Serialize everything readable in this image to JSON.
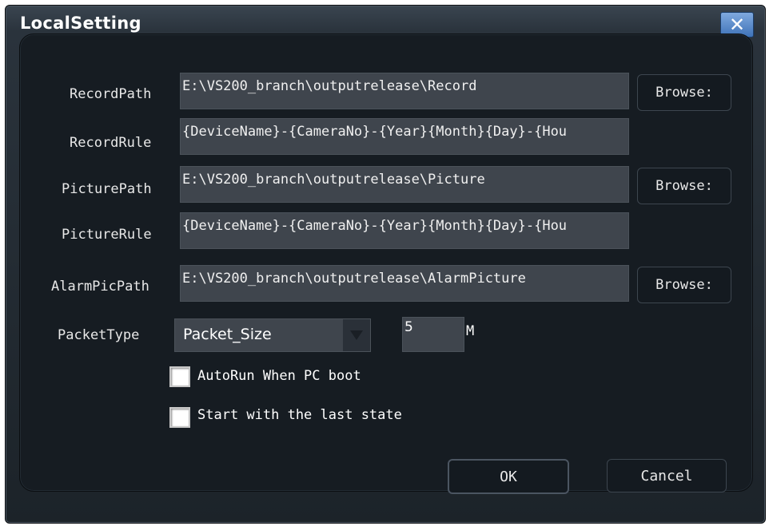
{
  "window": {
    "title": "LocalSetting",
    "close_glyph": "✕"
  },
  "form": {
    "record_path": {
      "label": "RecordPath",
      "value": "E:\\VS200_branch\\outputrelease\\Record",
      "browse_label": "Browse:"
    },
    "record_rule": {
      "label": "RecordRule",
      "value": "{DeviceName}-{CameraNo}-{Year}{Month}{Day}-{Hou"
    },
    "picture_path": {
      "label": "PicturePath",
      "value": "E:\\VS200_branch\\outputrelease\\Picture",
      "browse_label": "Browse:"
    },
    "picture_rule": {
      "label": "PictureRule",
      "value": "{DeviceName}-{CameraNo}-{Year}{Month}{Day}-{Hou"
    },
    "alarm_pic_path": {
      "label": "AlarmPicPath",
      "value": "E:\\VS200_branch\\outputrelease\\AlarmPicture",
      "browse_label": "Browse:"
    },
    "packet_type": {
      "label": "PacketType",
      "selected": "Packet_Size",
      "size_value": "5",
      "unit": "M"
    },
    "autorun": {
      "label": "AutoRun When PC boot",
      "checked": false
    },
    "last_state": {
      "label": "Start with the last state",
      "checked": false
    }
  },
  "buttons": {
    "ok": "OK",
    "cancel": "Cancel"
  },
  "colors": {
    "dialog_bg": "#1c2329",
    "field_bg": "#3f454d",
    "close_button": "#4f82c4"
  }
}
